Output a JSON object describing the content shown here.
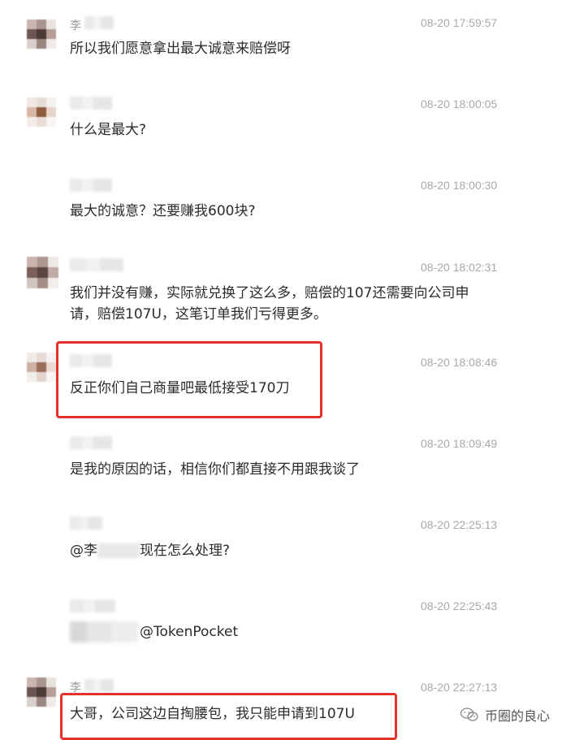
{
  "messages": [
    {
      "name": "李",
      "time": "08-20 17:59:57",
      "text": "所以我们愿意拿出最大诚意来赔偿呀"
    },
    {
      "name": "",
      "time": "08-20 18:00:05",
      "text": "什么是最大?"
    },
    {
      "name": "",
      "time": "08-20 18:00:30",
      "text": "最大的诚意？还要赚我600块?"
    },
    {
      "name": "",
      "time": "08-20 18:02:31",
      "text": "我们并没有赚，实际就兑换了这么多，赔偿的107还需要向公司申请，赔偿107U，这笔订单我们亏得更多。"
    },
    {
      "name": "",
      "time": "08-20 18:08:46",
      "text": "反正你们自己商量吧最低接受170刀"
    },
    {
      "name": "",
      "time": "08-20 18:09:49",
      "text": "是我的原因的话，相信你们都直接不用跟我谈了"
    },
    {
      "name": "",
      "time": "08-20 22:25:13",
      "text_prefix": "@李",
      "text_suffix": "现在怎么处理?"
    },
    {
      "name": "",
      "time": "08-20 22:25:43",
      "text": "@TokenPocket"
    },
    {
      "name": "李",
      "time": "08-20 22:27:13",
      "text": "大哥，公司这边自掏腰包，我只能申请到107U"
    }
  ],
  "watermark": {
    "text": "币圈的良心",
    "icon": "wechat-icon"
  },
  "colors": {
    "highlight": "#e4322b",
    "time": "#a8a8a8",
    "text": "#2b2b2b"
  }
}
